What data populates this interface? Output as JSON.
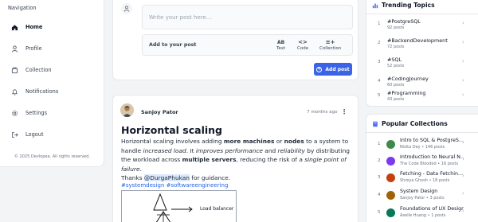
{
  "sidebar": {
    "title": "Navigation",
    "items": [
      {
        "label": "Home",
        "icon": "home-icon"
      },
      {
        "label": "Profile",
        "icon": "user-icon"
      },
      {
        "label": "Collection",
        "icon": "collection-icon"
      },
      {
        "label": "Notifications",
        "icon": "bell-icon"
      },
      {
        "label": "Settings",
        "icon": "gear-icon"
      },
      {
        "label": "Logout",
        "icon": "logout-icon"
      }
    ],
    "copyright": "© 2025 Devlopea. All rights reserved."
  },
  "composer": {
    "placeholder": "Write your post here...",
    "add_label": "Add to your post",
    "tools": [
      {
        "label": "Text",
        "glyph": "AB"
      },
      {
        "label": "Code",
        "glyph": "<>"
      },
      {
        "label": "Collection",
        "glyph": "≡+"
      }
    ],
    "submit_label": "Add post",
    "submit_color": "#3b63e6"
  },
  "post": {
    "author": "Sanjoy Pator",
    "time": "7 months ago",
    "menu": "⋮",
    "title": "Horizontal scaling",
    "body": {
      "s1": "Horizontal scaling involves adding ",
      "s2": "more machines",
      "s3": " or ",
      "s4": "nodes",
      "s5": " to a system to handle ",
      "s6": "increased load",
      "s7": ". It ",
      "s8": "improves performance",
      "s9": " and ",
      "s10": "reliability",
      "s11": " by distributing the workload across ",
      "s12": "multiple servers",
      "s13": ", reducing the risk of a ",
      "s14": "single point of failure",
      "s15": "."
    },
    "thanks_prefix": "Thanks ",
    "mention": "@DurgaPhukan",
    "thanks_suffix": " for guidance.",
    "hashtags": "#systemdesign #softwareengineering",
    "diagram_label": "Load balancer"
  },
  "trending": {
    "title": "Trending Topics",
    "items": [
      {
        "num": "1",
        "tag": "#PostgreSQL",
        "posts": "92 posts"
      },
      {
        "num": "2",
        "tag": "#BackendDevelopment",
        "posts": "72 posts"
      },
      {
        "num": "3",
        "tag": "#SQL",
        "posts": "52 posts"
      },
      {
        "num": "4",
        "tag": "#CodingJourney",
        "posts": "60 posts"
      },
      {
        "num": "5",
        "tag": "#Programming",
        "posts": "43 posts"
      }
    ]
  },
  "collections": {
    "title": "Popular Collections",
    "items": [
      {
        "num": "1",
        "title": "Intro to SQL & PostgreS...",
        "meta": "Nisita Dey • 146 posts",
        "color": "#3f8a4a"
      },
      {
        "num": "2",
        "title": "Introduction to Neural N...",
        "meta": "The Code Blooded • 16 posts",
        "color": "#7c3aed"
      },
      {
        "num": "3",
        "title": "Fetching - Data Fetchin...",
        "meta": "Shreya Ghosh • 18 posts",
        "color": "#c2410c"
      },
      {
        "num": "4",
        "title": "System Design",
        "meta": "Sanjoy Pator • 3 posts",
        "color": "#a16207"
      },
      {
        "num": "5",
        "title": "Foundations of UX Design",
        "meta": "Axelle Huang • 1 posts",
        "color": "#047857"
      }
    ]
  }
}
